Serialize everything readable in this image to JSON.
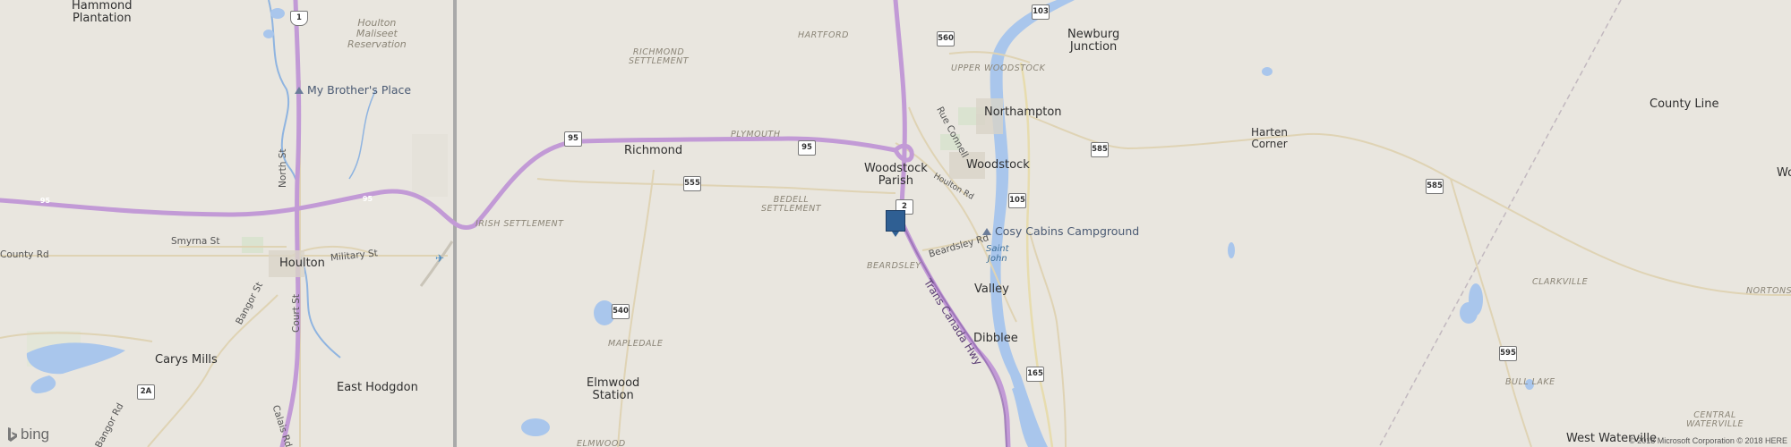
{
  "places": {
    "hammond_plantation": "Hammond\nPlantation",
    "houlton_reservation": "Houlton\nMaliseet\nReservation",
    "newburg_junction": "Newburg\nJunction",
    "northampton": "Northampton",
    "harten_corner": "Harten\nCorner",
    "county_line": "County Line",
    "richmond": "Richmond",
    "woodstock_parish": "Woodstock\nParish",
    "woodstock": "Woodstock",
    "houlton": "Houlton",
    "valley": "Valley",
    "dibblee": "Dibblee",
    "carys_mills": "Carys Mills",
    "east_hodgdon": "East Hodgdon",
    "elmwood_station": "Elmwood\nStation",
    "west_waterville": "West Waterville",
    "wo_partial": "Wo"
  },
  "areas": {
    "hartford": "HARTFORD",
    "richmond_settlement": "RICHMOND\nSETTLEMENT",
    "upper_woodstock": "UPPER WOODSTOCK",
    "plymouth": "PLYMOUTH",
    "bedell_settlement": "BEDELL\nSETTLEMENT",
    "irish_settlement": "IRISH SETTLEMENT",
    "beardsley": "BEARDSLEY",
    "mapledale": "MAPLEDALE",
    "clarkville": "CLARKVILLE",
    "nortons": "NORTONS",
    "bull_lake": "BULL LAKE",
    "central_waterville": "CENTRAL\nWATERVILLE",
    "elmwood": "ELMWOOD"
  },
  "roads": {
    "county_rd": "County Rd",
    "smyrna_st": "Smyrna St",
    "military_st": "Military St",
    "north_st": "North St",
    "court_st": "Court St",
    "bangor_st": "Bangor St",
    "bangor_rd": "Bangor Rd",
    "calais_rd": "Calais Rd",
    "rue_connell": "Rue Connell",
    "houlton_rd": "Houlton Rd",
    "beardsley_rd": "Beardsley Rd",
    "trans_canada_hwy": "Trans Canada Hwy"
  },
  "water": {
    "saint_john": "Saint\nJohn"
  },
  "pois": {
    "my_brothers_place": "My Brother's Place",
    "cosy_cabins": "Cosy Cabins Campground"
  },
  "shields": {
    "us1": "1",
    "i95_left": "95",
    "i95_mid": "95",
    "r95_a": "95",
    "r95_b": "95",
    "r103": "103",
    "r560": "560",
    "r555": "555",
    "r585_a": "585",
    "r585_b": "585",
    "r2": "2",
    "r105": "105",
    "r540": "540",
    "r165": "165",
    "r595": "595",
    "r2a": "2A"
  },
  "footer": {
    "logo_text": "bing",
    "copyright": "© 2018 Microsoft Corporation © 2018 HERE"
  },
  "colors": {
    "land": "#e9e6df",
    "highway": "#c29ad6",
    "river": "#a9c6ec",
    "marker": "#2f5f93"
  }
}
